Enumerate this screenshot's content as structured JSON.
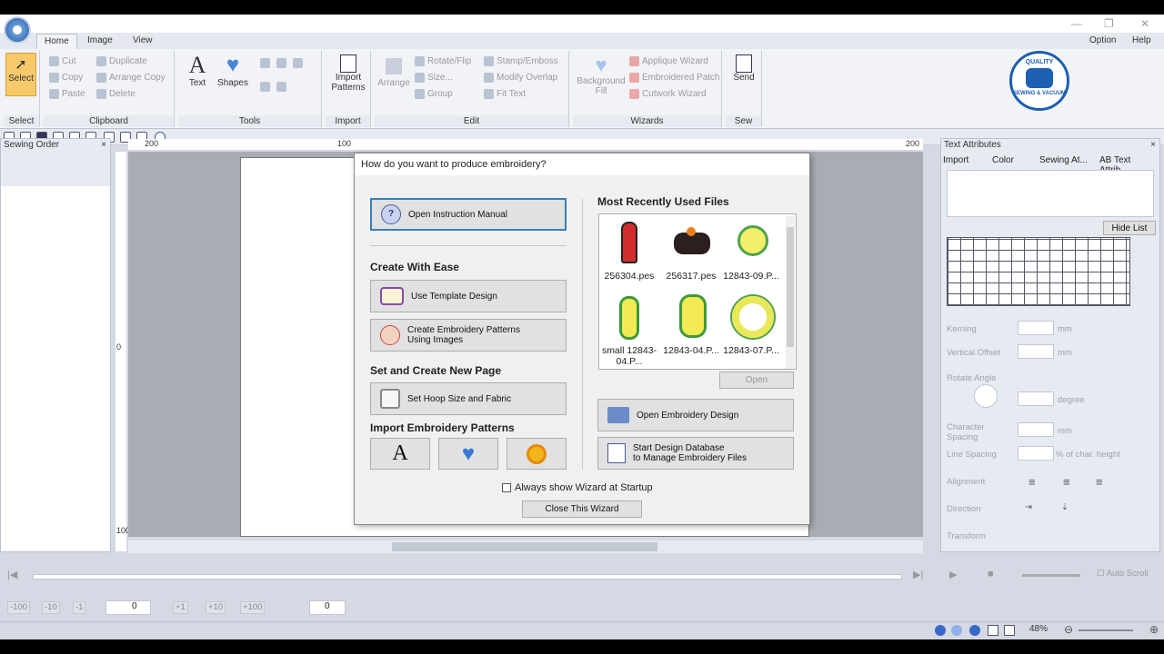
{
  "ribbon_tabs": [
    "Home",
    "Image",
    "View"
  ],
  "top_right": {
    "option": "Option",
    "help": "Help"
  },
  "ribbon": {
    "select": {
      "label": "Select",
      "group": "Select"
    },
    "clipboard": {
      "cut": "Cut",
      "copy": "Copy",
      "paste": "Paste",
      "duplicate": "Duplicate",
      "arrange_copy": "Arrange Copy",
      "delete": "Delete",
      "group": "Clipboard"
    },
    "tools": {
      "text": "Text",
      "shapes": "Shapes",
      "group": "Tools"
    },
    "import": {
      "label": "Import Patterns",
      "group": "Import"
    },
    "edit": {
      "arrange": "Arrange",
      "rotate": "Rotate/Flip",
      "size": "Size...",
      "group_btn": "Group",
      "stamp": "Stamp/Emboss",
      "modify": "Modify Overlap",
      "fit": "Fit Text",
      "group": "Edit"
    },
    "wizards": {
      "background": "Background Fill",
      "applique": "Applique Wizard",
      "patch": "Embroidered Patch",
      "cutwork": "Cutwork Wizard",
      "group": "Wizards"
    },
    "sew": {
      "send": "Send",
      "group": "Sew"
    }
  },
  "logo": {
    "top": "QUALITY",
    "bottom": "SEWING & VACUUM"
  },
  "sewing_order": {
    "title": "Sewing Order"
  },
  "rulers": {
    "top_left": "200",
    "top_mid": "100",
    "top_right": "200",
    "left_mid": "0",
    "left_bottom": "100"
  },
  "dialog": {
    "title": "How do you want to produce embroidery?",
    "manual": "Open Instruction Manual",
    "create_with_ease": "Create With Ease",
    "template": "Use Template Design",
    "images": "Create Embroidery Patterns\n Using Images",
    "set_create": "Set and Create New Page",
    "hoop": "Set Hoop Size and Fabric",
    "import_patterns": "Import Embroidery Patterns",
    "letter_a": "A",
    "mru_title": "Most Recently Used Files",
    "mru_files": [
      "256304.pes",
      "256317.pes",
      "12843-09.P...",
      "small 12843-04.P...",
      "12843-04.P...",
      "12843-07.P..."
    ],
    "open": "Open",
    "open_design": "Open Embroidery Design",
    "database": "Start Design Database\n to Manage Embroidery Files",
    "always_show": "Always show Wizard at Startup",
    "close": "Close This Wizard"
  },
  "text_attributes": {
    "title": "Text Attributes",
    "tabs": [
      "Import",
      "Color",
      "Sewing At...",
      "AB Text Attrib..."
    ],
    "hide_list": "Hide List",
    "kerning": "Kerning",
    "mm1": "mm",
    "vertical_offset": "Vertical Offset",
    "mm2": "mm",
    "rotate_angle": "Rotate Angle",
    "degree": "degree",
    "char_spacing": "Character Spacing",
    "mm3": "mm",
    "line_spacing": "Line Spacing",
    "charh": "% of char. height",
    "alignment": "Alignment",
    "direction": "Direction",
    "transform": "Transform"
  },
  "bottom": {
    "auto_scroll": "Auto Scroll",
    "zoom": "48%",
    "zero": "0"
  },
  "colors": {
    "accent": "#3c7fb1",
    "ribbon_bg": "#f1f3f7",
    "canvas_bg": "#a9acb3"
  }
}
